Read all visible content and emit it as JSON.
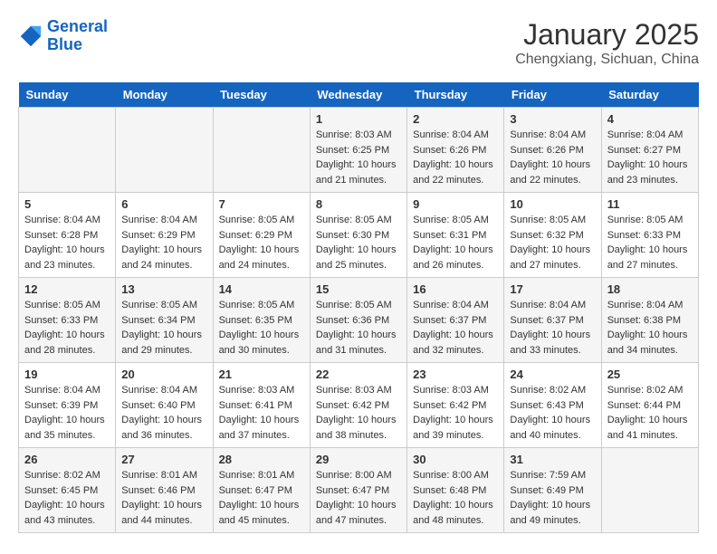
{
  "header": {
    "logo_line1": "General",
    "logo_line2": "Blue",
    "title": "January 2025",
    "subtitle": "Chengxiang, Sichuan, China"
  },
  "days_of_week": [
    "Sunday",
    "Monday",
    "Tuesday",
    "Wednesday",
    "Thursday",
    "Friday",
    "Saturday"
  ],
  "weeks": [
    [
      {
        "day": "",
        "info": ""
      },
      {
        "day": "",
        "info": ""
      },
      {
        "day": "",
        "info": ""
      },
      {
        "day": "1",
        "info": "Sunrise: 8:03 AM\nSunset: 6:25 PM\nDaylight: 10 hours\nand 21 minutes."
      },
      {
        "day": "2",
        "info": "Sunrise: 8:04 AM\nSunset: 6:26 PM\nDaylight: 10 hours\nand 22 minutes."
      },
      {
        "day": "3",
        "info": "Sunrise: 8:04 AM\nSunset: 6:26 PM\nDaylight: 10 hours\nand 22 minutes."
      },
      {
        "day": "4",
        "info": "Sunrise: 8:04 AM\nSunset: 6:27 PM\nDaylight: 10 hours\nand 23 minutes."
      }
    ],
    [
      {
        "day": "5",
        "info": "Sunrise: 8:04 AM\nSunset: 6:28 PM\nDaylight: 10 hours\nand 23 minutes."
      },
      {
        "day": "6",
        "info": "Sunrise: 8:04 AM\nSunset: 6:29 PM\nDaylight: 10 hours\nand 24 minutes."
      },
      {
        "day": "7",
        "info": "Sunrise: 8:05 AM\nSunset: 6:29 PM\nDaylight: 10 hours\nand 24 minutes."
      },
      {
        "day": "8",
        "info": "Sunrise: 8:05 AM\nSunset: 6:30 PM\nDaylight: 10 hours\nand 25 minutes."
      },
      {
        "day": "9",
        "info": "Sunrise: 8:05 AM\nSunset: 6:31 PM\nDaylight: 10 hours\nand 26 minutes."
      },
      {
        "day": "10",
        "info": "Sunrise: 8:05 AM\nSunset: 6:32 PM\nDaylight: 10 hours\nand 27 minutes."
      },
      {
        "day": "11",
        "info": "Sunrise: 8:05 AM\nSunset: 6:33 PM\nDaylight: 10 hours\nand 27 minutes."
      }
    ],
    [
      {
        "day": "12",
        "info": "Sunrise: 8:05 AM\nSunset: 6:33 PM\nDaylight: 10 hours\nand 28 minutes."
      },
      {
        "day": "13",
        "info": "Sunrise: 8:05 AM\nSunset: 6:34 PM\nDaylight: 10 hours\nand 29 minutes."
      },
      {
        "day": "14",
        "info": "Sunrise: 8:05 AM\nSunset: 6:35 PM\nDaylight: 10 hours\nand 30 minutes."
      },
      {
        "day": "15",
        "info": "Sunrise: 8:05 AM\nSunset: 6:36 PM\nDaylight: 10 hours\nand 31 minutes."
      },
      {
        "day": "16",
        "info": "Sunrise: 8:04 AM\nSunset: 6:37 PM\nDaylight: 10 hours\nand 32 minutes."
      },
      {
        "day": "17",
        "info": "Sunrise: 8:04 AM\nSunset: 6:37 PM\nDaylight: 10 hours\nand 33 minutes."
      },
      {
        "day": "18",
        "info": "Sunrise: 8:04 AM\nSunset: 6:38 PM\nDaylight: 10 hours\nand 34 minutes."
      }
    ],
    [
      {
        "day": "19",
        "info": "Sunrise: 8:04 AM\nSunset: 6:39 PM\nDaylight: 10 hours\nand 35 minutes."
      },
      {
        "day": "20",
        "info": "Sunrise: 8:04 AM\nSunset: 6:40 PM\nDaylight: 10 hours\nand 36 minutes."
      },
      {
        "day": "21",
        "info": "Sunrise: 8:03 AM\nSunset: 6:41 PM\nDaylight: 10 hours\nand 37 minutes."
      },
      {
        "day": "22",
        "info": "Sunrise: 8:03 AM\nSunset: 6:42 PM\nDaylight: 10 hours\nand 38 minutes."
      },
      {
        "day": "23",
        "info": "Sunrise: 8:03 AM\nSunset: 6:42 PM\nDaylight: 10 hours\nand 39 minutes."
      },
      {
        "day": "24",
        "info": "Sunrise: 8:02 AM\nSunset: 6:43 PM\nDaylight: 10 hours\nand 40 minutes."
      },
      {
        "day": "25",
        "info": "Sunrise: 8:02 AM\nSunset: 6:44 PM\nDaylight: 10 hours\nand 41 minutes."
      }
    ],
    [
      {
        "day": "26",
        "info": "Sunrise: 8:02 AM\nSunset: 6:45 PM\nDaylight: 10 hours\nand 43 minutes."
      },
      {
        "day": "27",
        "info": "Sunrise: 8:01 AM\nSunset: 6:46 PM\nDaylight: 10 hours\nand 44 minutes."
      },
      {
        "day": "28",
        "info": "Sunrise: 8:01 AM\nSunset: 6:47 PM\nDaylight: 10 hours\nand 45 minutes."
      },
      {
        "day": "29",
        "info": "Sunrise: 8:00 AM\nSunset: 6:47 PM\nDaylight: 10 hours\nand 47 minutes."
      },
      {
        "day": "30",
        "info": "Sunrise: 8:00 AM\nSunset: 6:48 PM\nDaylight: 10 hours\nand 48 minutes."
      },
      {
        "day": "31",
        "info": "Sunrise: 7:59 AM\nSunset: 6:49 PM\nDaylight: 10 hours\nand 49 minutes."
      },
      {
        "day": "",
        "info": ""
      }
    ]
  ]
}
